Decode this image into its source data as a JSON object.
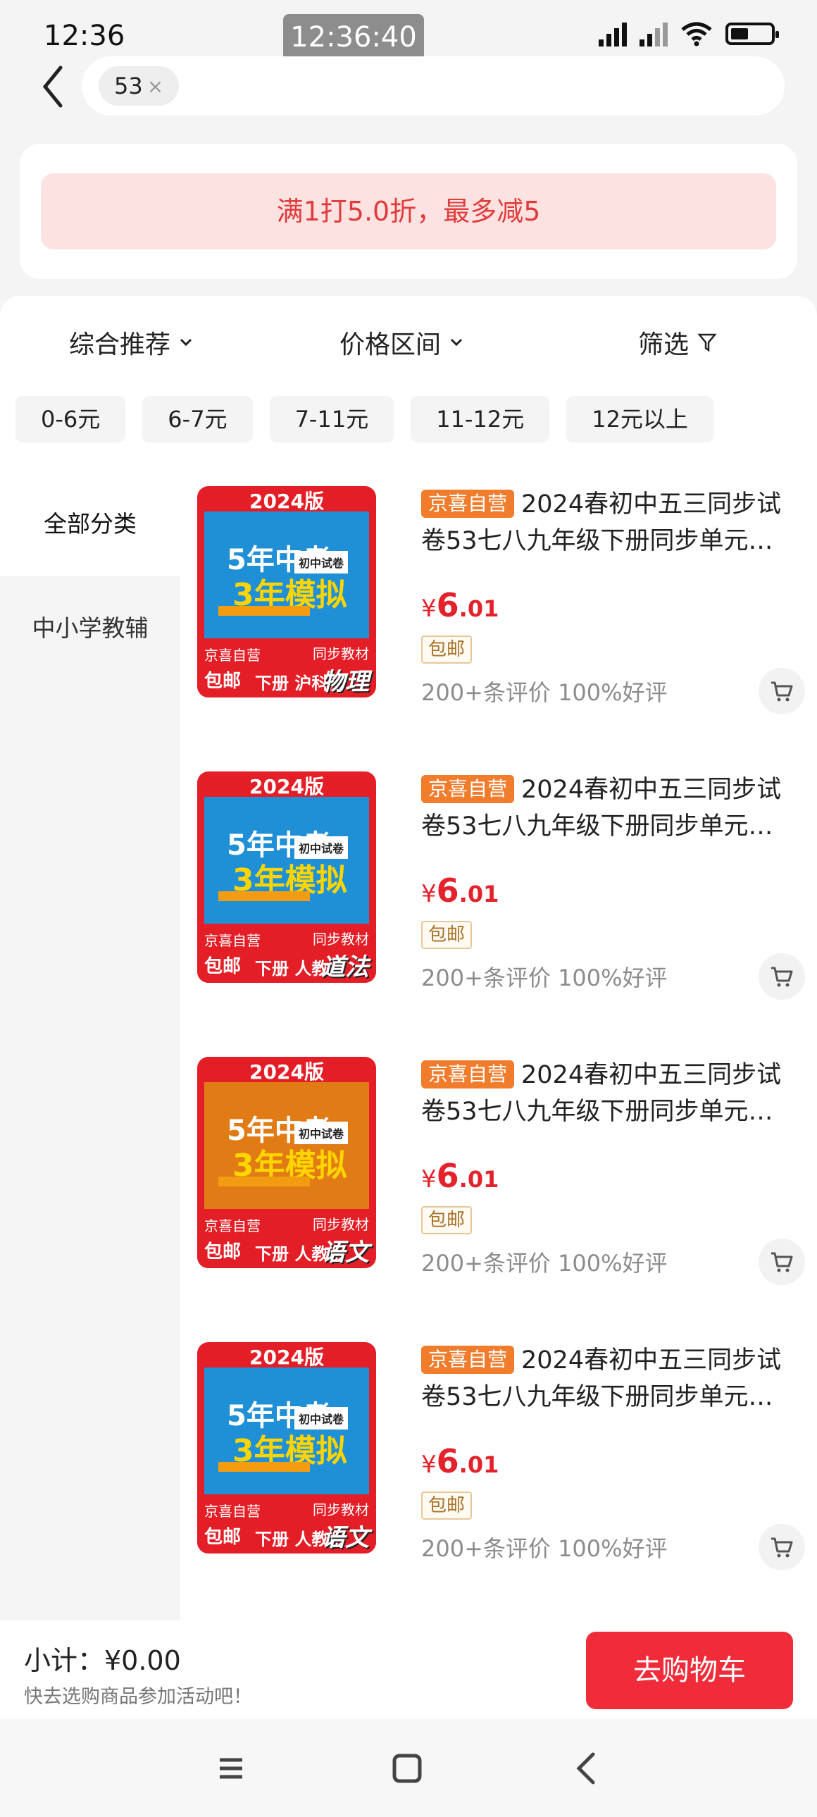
{
  "status_bar": {
    "time": "12:36",
    "clock_badge": "12:36:40"
  },
  "search": {
    "chip_label": "53",
    "chip_close": "×"
  },
  "promo": {
    "text": "满1打5.0折，最多减5"
  },
  "sort_bar": {
    "items": [
      {
        "label": "综合推荐"
      },
      {
        "label": "价格区间"
      },
      {
        "label": "筛选"
      }
    ]
  },
  "price_filters": [
    "0-6元",
    "6-7元",
    "7-11元",
    "11-12元",
    "12元以上"
  ],
  "sidebar": {
    "items": [
      {
        "label": "全部分类"
      },
      {
        "label": "中小学教辅"
      }
    ]
  },
  "products": [
    {
      "badge": "京喜自营",
      "title_line1": "2024春初中五三同步试",
      "title_line2": "卷53七八九年级下册同步单元…",
      "price_yen": "¥",
      "price_int": "6",
      "price_dec": ".01",
      "shipping": "包邮",
      "reviews": "200+条评价  100%好评",
      "cover": {
        "year": "2024版",
        "t1": "5年中考",
        "t2": "3年模拟",
        "tag": "初中试卷",
        "b1": "京喜自营",
        "b2": "包邮",
        "b3": "下册 沪科版",
        "b4": "同步教材",
        "b5": "物理",
        "color": "#1f8fd6"
      }
    },
    {
      "badge": "京喜自营",
      "title_line1": "2024春初中五三同步试",
      "title_line2": "卷53七八九年级下册同步单元…",
      "price_yen": "¥",
      "price_int": "6",
      "price_dec": ".01",
      "shipping": "包邮",
      "reviews": "200+条评价  100%好评",
      "cover": {
        "year": "2024版",
        "t1": "5年中考",
        "t2": "3年模拟",
        "tag": "初中试卷",
        "b1": "京喜自营",
        "b2": "包邮",
        "b3": "下册 人教版",
        "b4": "同步教材",
        "b5": "道法",
        "color": "#1f8fd6"
      }
    },
    {
      "badge": "京喜自营",
      "title_line1": "2024春初中五三同步试",
      "title_line2": "卷53七八九年级下册同步单元…",
      "price_yen": "¥",
      "price_int": "6",
      "price_dec": ".01",
      "shipping": "包邮",
      "reviews": "200+条评价  100%好评",
      "cover": {
        "year": "2024版",
        "t1": "5年中考",
        "t2": "3年模拟",
        "tag": "初中试卷",
        "b1": "京喜自营",
        "b2": "包邮",
        "b3": "下册 人教版",
        "b4": "同步教材",
        "b5": "语文",
        "color": "#e07b16"
      }
    },
    {
      "badge": "京喜自营",
      "title_line1": "2024春初中五三同步试",
      "title_line2": "卷53七八九年级下册同步单元…",
      "price_yen": "¥",
      "price_int": "6",
      "price_dec": ".01",
      "shipping": "包邮",
      "reviews": "200+条评价  100%好评",
      "cover": {
        "year": "2024版",
        "t1": "5年中考",
        "t2": "3年模拟",
        "tag": "初中试卷",
        "b1": "京喜自营",
        "b2": "包邮",
        "b3": "下册 人教版",
        "b4": "同步教材",
        "b5": "语文",
        "color": "#1f8fd6"
      }
    }
  ],
  "bottom": {
    "subtotal": "小计：¥0.00",
    "hint": "快去选购商品参加活动吧！",
    "go_cart": "去购物车"
  },
  "colors": {
    "accent_red": "#f02b3a",
    "price_red": "#e4222b",
    "self_badge_orange": "#f07c2c",
    "promo_bg": "#fde2e2"
  }
}
